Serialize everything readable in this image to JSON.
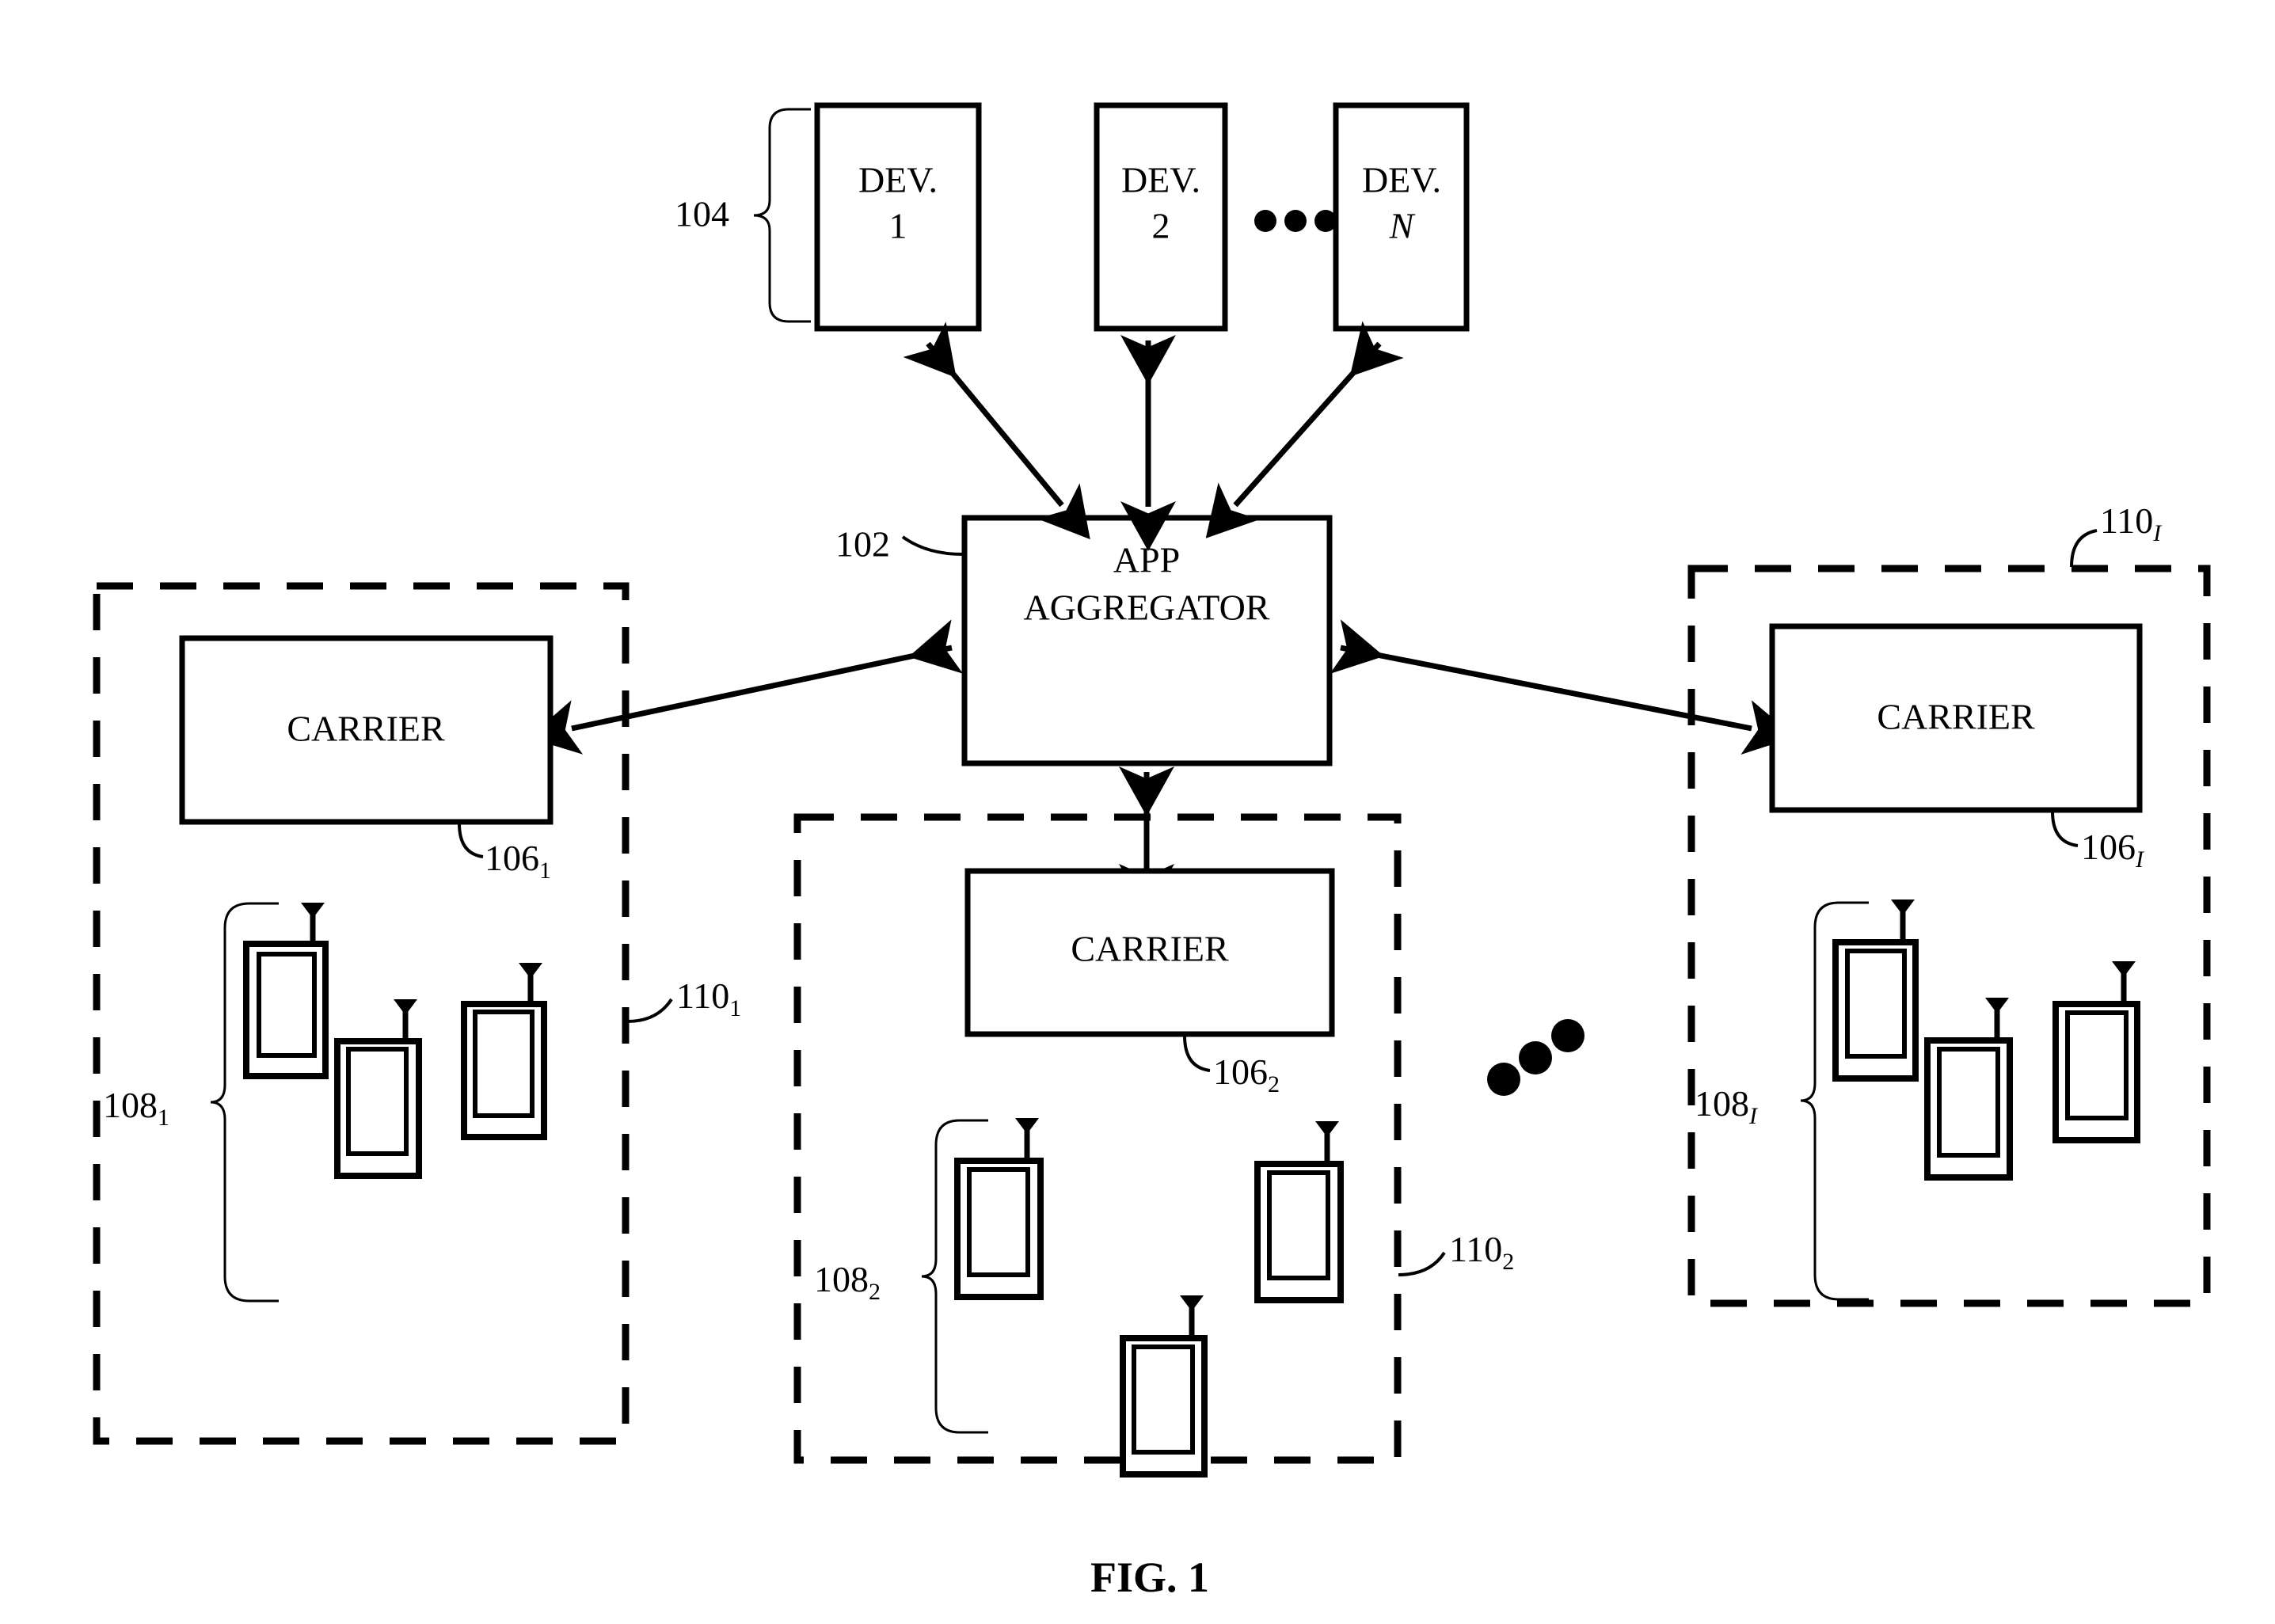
{
  "figure": {
    "caption": "FIG. 1",
    "title": "App Aggregator network architecture diagram"
  },
  "aggregator": {
    "label_line1": "APP",
    "label_line2": "AGGREGATOR",
    "ref": "102"
  },
  "devices": {
    "group_ref": "104",
    "ellipsis": "• • •",
    "items": [
      {
        "line1": "DEV.",
        "line2": "1"
      },
      {
        "line1": "DEV.",
        "line2": "2"
      },
      {
        "line1": "DEV.",
        "line2": "N"
      }
    ]
  },
  "regions": [
    {
      "id": "left",
      "region_ref_base": "110",
      "region_ref_sub": "1",
      "carrier_label": "CARRIER",
      "carrier_ref_base": "106",
      "carrier_ref_sub": "1",
      "devices_ref_base": "108",
      "devices_ref_sub": "1",
      "phone_count": 3
    },
    {
      "id": "middle",
      "region_ref_base": "110",
      "region_ref_sub": "2",
      "carrier_label": "CARRIER",
      "carrier_ref_base": "106",
      "carrier_ref_sub": "2",
      "devices_ref_base": "108",
      "devices_ref_sub": "2",
      "phone_count": 3
    },
    {
      "id": "right",
      "region_ref_base": "110",
      "region_ref_sub": "I",
      "carrier_label": "CARRIER",
      "carrier_ref_base": "106",
      "carrier_ref_sub": "I",
      "devices_ref_base": "108",
      "devices_ref_sub": "I",
      "phone_count": 3
    }
  ],
  "region_ellipsis": "• • •",
  "colors": {
    "ink": "#000000",
    "paper": "#ffffff"
  }
}
